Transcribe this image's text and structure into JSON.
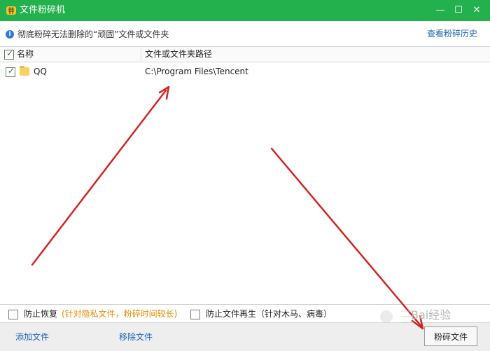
{
  "window": {
    "title": "文件粉碎机",
    "controls": {
      "minimize": "—",
      "maximize": "☐",
      "close": "✕"
    },
    "icons": {
      "app": "shredder-app-icon"
    }
  },
  "info": {
    "icon": "info-icon",
    "text": "彻底粉碎无法删除的“顽固”文件或文件夹",
    "history_link": "查看粉碎历史"
  },
  "table": {
    "columns": [
      "名称",
      "文件或文件夹路径"
    ],
    "rows": [
      {
        "checked": true,
        "name": "QQ",
        "path": "C:\\Program Files\\Tencent",
        "icon": "folder-icon"
      }
    ]
  },
  "options": {
    "prevent_recovery": {
      "label": "防止恢复",
      "note": "(针对隐私文件，粉碎时间较长)"
    },
    "prevent_regen": {
      "label": "防止文件再生（针对木马、病毒）"
    }
  },
  "footer": {
    "add_file": "添加文件",
    "remove_file": "移除文件",
    "shred_button": "粉碎文件"
  },
  "colors": {
    "title_bar": "#23b14d",
    "link": "#1f64b7",
    "note": "#e28d00",
    "arrow": "#d32424"
  },
  "watermark": {
    "text": "Bai经验"
  }
}
